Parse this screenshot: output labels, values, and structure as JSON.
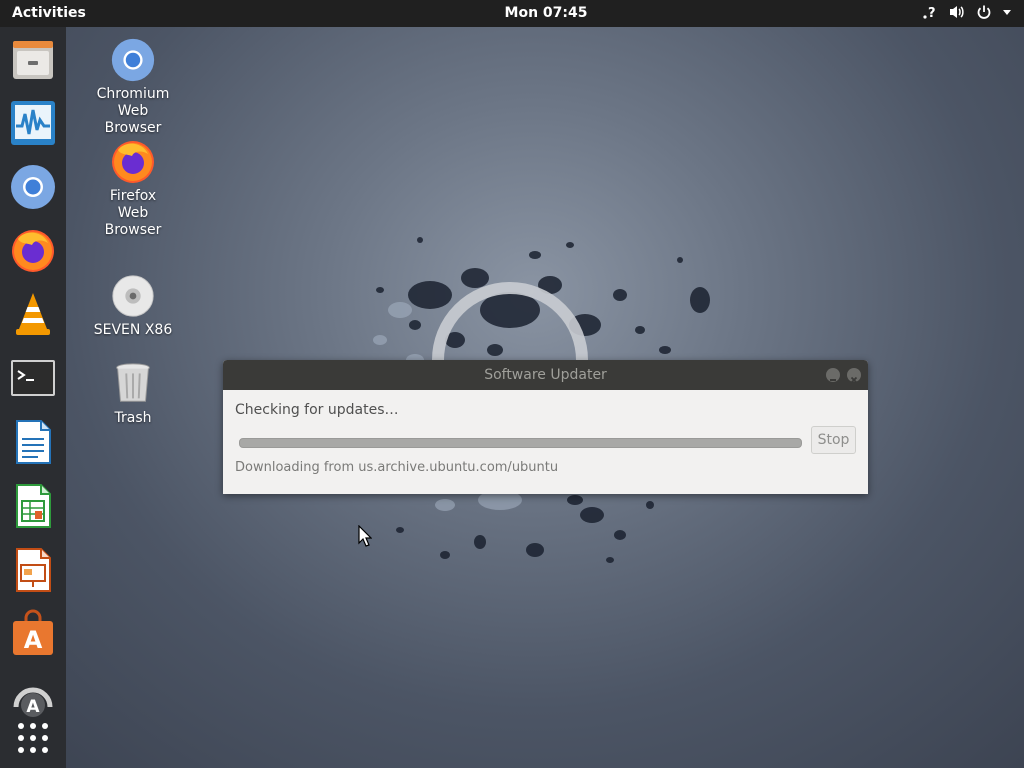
{
  "topbar": {
    "activities": "Activities",
    "clock": "Mon 07:45",
    "tray_icons": [
      "network-question-icon",
      "volume-icon",
      "power-icon",
      "dropdown-arrow-icon"
    ]
  },
  "dock": {
    "items": [
      {
        "name": "files",
        "icon": "file-cabinet-icon"
      },
      {
        "name": "system-monitor",
        "icon": "monitor-icon"
      },
      {
        "name": "chromium",
        "icon": "chromium-icon"
      },
      {
        "name": "firefox",
        "icon": "firefox-icon"
      },
      {
        "name": "vlc",
        "icon": "vlc-cone-icon"
      },
      {
        "name": "terminal",
        "icon": "terminal-icon"
      },
      {
        "name": "libreoffice-writer",
        "icon": "writer-icon"
      },
      {
        "name": "libreoffice-calc",
        "icon": "calc-icon"
      },
      {
        "name": "libreoffice-impress",
        "icon": "impress-icon"
      },
      {
        "name": "software-center",
        "icon": "software-bag-icon"
      },
      {
        "name": "software-updater",
        "icon": "updater-icon"
      },
      {
        "name": "show-applications",
        "icon": "app-grid-icon"
      }
    ]
  },
  "desktop": {
    "icons": [
      {
        "label_lines": [
          "Chromium",
          "Web",
          "Browser"
        ]
      },
      {
        "label_lines": [
          "Firefox",
          "Web",
          "Browser"
        ]
      },
      {
        "label_lines": [
          "SEVEN X86"
        ]
      },
      {
        "label_lines": [
          "Trash"
        ]
      }
    ]
  },
  "dialog": {
    "title": "Software Updater",
    "status": "Checking for updates…",
    "stop_label": "Stop",
    "source": "Downloading from us.archive.ubuntu.com/ubuntu",
    "progress": 0
  },
  "colors": {
    "topbar": "#202020",
    "dock": "#2b2d31",
    "dialog_title": "#3a3a38",
    "dialog_body": "#f2f1f0"
  }
}
